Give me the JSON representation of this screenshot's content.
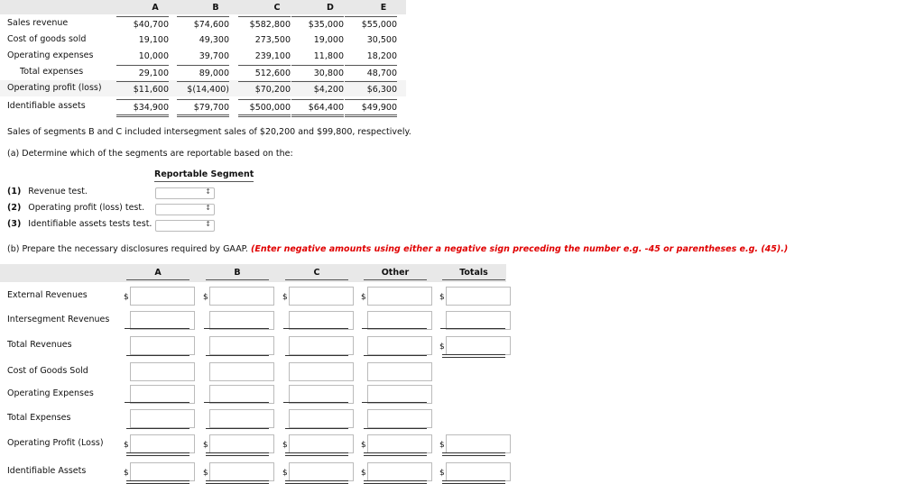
{
  "table1": {
    "columns": [
      "A",
      "B",
      "C",
      "D",
      "E"
    ],
    "rows": [
      {
        "label": "Sales revenue",
        "values": [
          "$40,700",
          "$74,600",
          "$582,800",
          "$35,000",
          "$55,000"
        ]
      },
      {
        "label": "Cost of goods sold",
        "values": [
          "19,100",
          "49,300",
          "273,500",
          "19,000",
          "30,500"
        ]
      },
      {
        "label": "Operating expenses",
        "values": [
          "10,000",
          "39,700",
          "239,100",
          "11,800",
          "18,200"
        ]
      },
      {
        "label": "Total expenses",
        "values": [
          "29,100",
          "89,000",
          "512,600",
          "30,800",
          "48,700"
        ]
      },
      {
        "label": "Operating profit (loss)",
        "values": [
          "$11,600",
          "$(14,400)",
          "$70,200",
          "$4,200",
          "$6,300"
        ]
      },
      {
        "label": "Identifiable assets",
        "values": [
          "$34,900",
          "$79,700",
          "$500,000",
          "$64,400",
          "$49,900"
        ]
      }
    ]
  },
  "note": "Sales of segments B and C included intersegment sales of $20,200 and $99,800, respectively.",
  "part_a": {
    "prompt": "(a) Determine which of the segments are reportable based on the:",
    "header": "Reportable Segment",
    "tests": [
      {
        "num": "(1)",
        "label": "Revenue test."
      },
      {
        "num": "(2)",
        "label": "Operating profit (loss) test."
      },
      {
        "num": "(3)",
        "label": "Identifiable assets tests test."
      }
    ]
  },
  "part_b": {
    "prompt": "(b) Prepare the necessary disclosures required by GAAP.",
    "instruction": "(Enter negative amounts using either a negative sign preceding the number e.g. -45 or parentheses e.g. (45).)",
    "columns": [
      "A",
      "B",
      "C",
      "Other",
      "Totals"
    ],
    "rows": [
      "External Revenues",
      "Intersegment Revenues",
      "Total Revenues",
      "Cost of Goods Sold",
      "Operating Expenses",
      "Total Expenses",
      "Operating Profit (Loss)",
      "Identifiable Assets"
    ],
    "dollar": "$"
  },
  "colors": {
    "instruction": "#e00000",
    "header_bg": "#e8e8e8"
  }
}
